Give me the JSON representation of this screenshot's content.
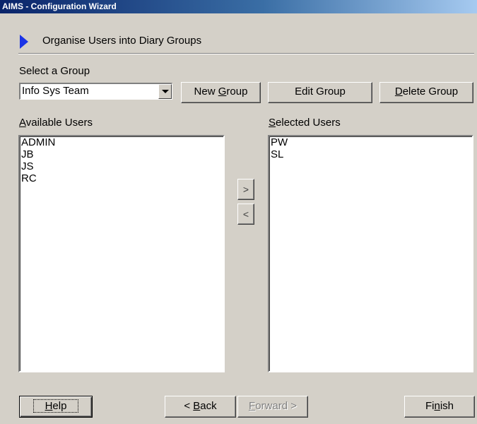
{
  "window": {
    "title": "AIMS - Configuration Wizard"
  },
  "step": {
    "title": "Organise Users into Diary Groups"
  },
  "group": {
    "label": "Select a Group",
    "selected": "Info Sys Team",
    "new_pre": "New ",
    "new_ul": "G",
    "new_post": "roup",
    "edit_label": "Edit Group",
    "delete_ul": "D",
    "delete_post": "elete Group"
  },
  "available": {
    "label_ul": "A",
    "label_rest": "vailable Users",
    "items": [
      "ADMIN",
      "JB",
      "JS",
      "RC"
    ]
  },
  "selected_users": {
    "label_ul": "S",
    "label_rest": "elected Users",
    "items": [
      "PW",
      "SL"
    ]
  },
  "transfer": {
    "add_glyph": ">",
    "remove_glyph": "<"
  },
  "footer": {
    "help_ul": "H",
    "help_rest": "elp",
    "back_pre": "< ",
    "back_ul": "B",
    "back_rest": "ack",
    "forward_ul": "F",
    "forward_rest": "orward >",
    "finish_pre": "Fi",
    "finish_ul": "n",
    "finish_rest": "ish"
  }
}
